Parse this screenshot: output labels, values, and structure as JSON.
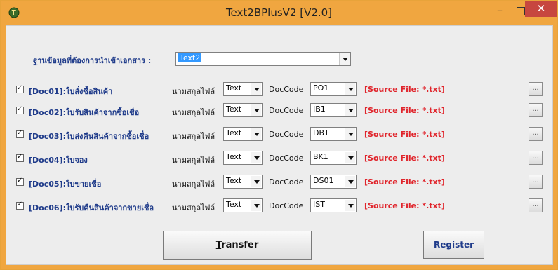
{
  "window": {
    "title": "Text2BPlusV2 [V2.0]",
    "min_glyph": "–",
    "close_glyph": "✕",
    "app_icon": "settings-wrench-icon"
  },
  "database": {
    "label_prefix": "ฐ",
    "label_rest": "านข้อมูลที่ต้องการนำเข้าเอกสาร :",
    "selected": "Text2"
  },
  "docs": [
    {
      "checked": true,
      "label": "[Doc01]:ใบสั่งซื้อสินค้า",
      "ext_label": "นามสกุลไฟล์",
      "ext": "Text",
      "code_label": "DocCode",
      "code": "PO1",
      "source": "[Source File: *.txt]",
      "browse": "..."
    },
    {
      "checked": true,
      "label": "[Doc02]:ใบรับสินค้าจากซื้อเชื่อ",
      "ext_label": "นามสกุลไฟล์",
      "ext": "Text",
      "code_label": "DocCode",
      "code": "IB1",
      "source": "[Source File: *.txt]",
      "browse": "..."
    },
    {
      "checked": true,
      "label": "[Doc03]:ใบส่งคืนสินค้าจากซื้อเชื่อ",
      "ext_label": "นามสกุลไฟล์",
      "ext": "Text",
      "code_label": "DocCode",
      "code": "DBT",
      "source": "[Source File: *.txt]",
      "browse": "..."
    },
    {
      "checked": true,
      "label": "[Doc04]:ใบจอง",
      "ext_label": "นามสกุลไฟล์",
      "ext": "Text",
      "code_label": "DocCode",
      "code": "BK1",
      "source": "[Source File: *.txt]",
      "browse": "..."
    },
    {
      "checked": true,
      "label": "[Doc05]:ใบขายเชื่อ",
      "ext_label": "นามสกุลไฟล์",
      "ext": "Text",
      "code_label": "DocCode",
      "code": "DS01",
      "source": "[Source File: *.txt]",
      "browse": "..."
    },
    {
      "checked": true,
      "label": "[Doc06]:ใบรับคืนสินค้าจากขายเชื่อ",
      "ext_label": "นามสกุลไฟล์",
      "ext": "Text",
      "code_label": "DocCode",
      "code": "IST",
      "source": "[Source File: *.txt]",
      "browse": "..."
    }
  ],
  "buttons": {
    "transfer": "Transfer",
    "register": "Register"
  },
  "colors": {
    "titlebar": "#f0a640",
    "close": "#c7473f",
    "label_blue": "#1f3b8a",
    "source_red": "#e0242b"
  }
}
